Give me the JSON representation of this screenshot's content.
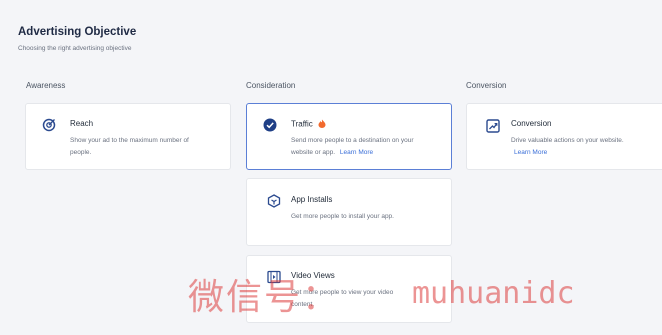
{
  "header": {
    "title": "Advertising Objective",
    "subtitle": "Choosing the right advertising objective"
  },
  "columns": {
    "awareness": "Awareness",
    "consideration": "Consideration",
    "conversion": "Conversion"
  },
  "cards": {
    "reach": {
      "title": "Reach",
      "desc1": "Show your ad to the maximum number of",
      "desc2": "people.",
      "icon": "target-icon"
    },
    "traffic": {
      "title": "Traffic",
      "desc1": "Send more people to a destination on your",
      "desc2": "website or app.",
      "link": "Learn More",
      "icon": "check-circle-icon",
      "badge_icon": "fire-icon",
      "selected": true
    },
    "conversion": {
      "title": "Conversion",
      "desc1": "Drive valuable actions on your website.",
      "link": "Learn More",
      "icon": "trend-up-icon"
    },
    "app_installs": {
      "title": "App Installs",
      "desc1": "Get more people to install your app.",
      "icon": "cube-icon"
    },
    "video_views": {
      "title": "Video Views",
      "desc1": "Get more people to view your video",
      "desc2": "content.",
      "icon": "video-icon"
    }
  },
  "watermark": {
    "cn": "微信号：",
    "en": "muhuanidc"
  },
  "colors": {
    "accent": "#3b6fd8",
    "selected_border": "#5b7fd6",
    "background": "#f4f5f8",
    "fire": "#f26a2e"
  }
}
